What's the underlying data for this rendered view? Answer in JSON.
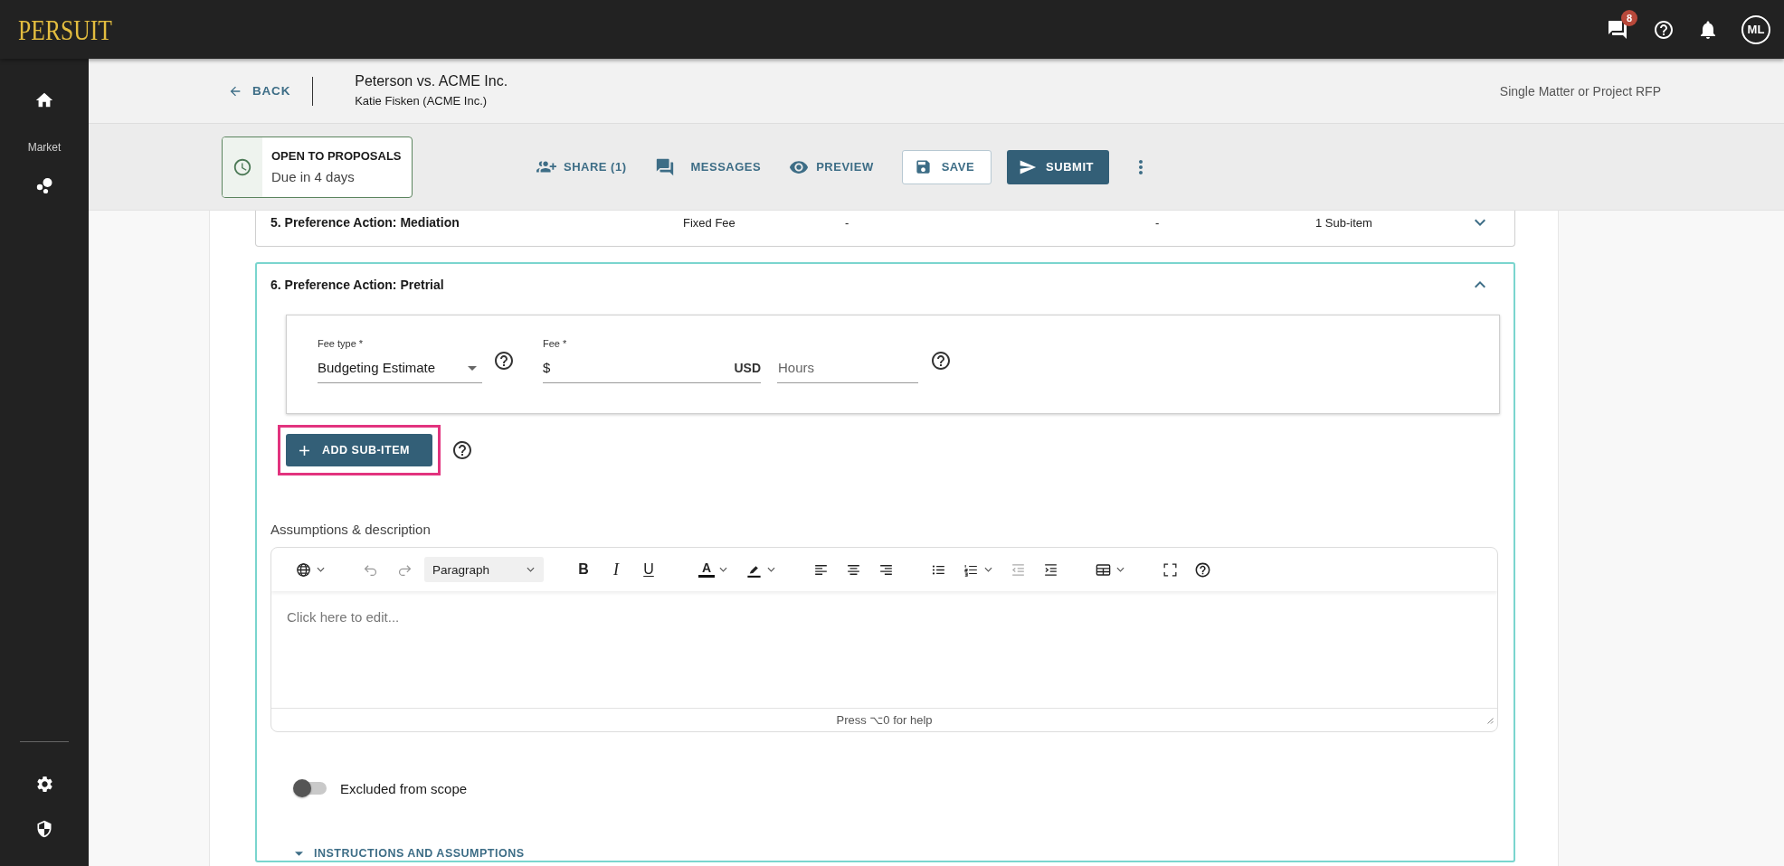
{
  "app_bar": {
    "logo": "PERSUIT",
    "messages_badge": "8",
    "avatar_initials": "ML"
  },
  "sidebar": {
    "section_label": "Market"
  },
  "header": {
    "back_label": "BACK",
    "title": "Peterson vs. ACME Inc.",
    "subtitle": "Katie Fisken (ACME Inc.)",
    "rfp_type": "Single Matter or Project RFP"
  },
  "status": {
    "title": "OPEN TO PROPOSALS",
    "due": "Due in 4 days"
  },
  "actions": [
    {
      "kind": "share",
      "label": "SHARE (1)"
    },
    {
      "kind": "messages",
      "label": "MESSAGES"
    },
    {
      "kind": "preview",
      "label": "PREVIEW"
    },
    {
      "kind": "save",
      "label": "SAVE"
    },
    {
      "kind": "submit",
      "label": "SUBMIT"
    }
  ],
  "line_items": [
    {
      "title": "5. Preference Action: Mediation",
      "expanded": false,
      "cells": [
        "Fixed Fee",
        "-",
        "-",
        "1 Sub-item"
      ]
    },
    {
      "title": "6. Preference Action: Pretrial",
      "expanded": true,
      "details": {
        "fee_type": {
          "label": "Fee type *",
          "value": "Budgeting Estimate"
        },
        "fee": {
          "label": "Fee *",
          "prefix": "$",
          "currency": "USD"
        },
        "hours": {
          "placeholder": "Hours"
        },
        "add_sub_item": {
          "label": "ADD SUB-ITEM",
          "highlighted": true
        },
        "description": {
          "label": "Assumptions & description",
          "block_format": "Paragraph",
          "format_buttons": [
            {
              "kind": "bold",
              "label": "B"
            },
            {
              "kind": "italic",
              "label": "I"
            },
            {
              "kind": "underline",
              "label": "U"
            }
          ],
          "text_color_label": "A",
          "placeholder": "Click here to edit...",
          "help_hint": "Press ⌥0 for help"
        },
        "excluded_from_scope": {
          "label": "Excluded from scope",
          "on": false
        },
        "instructions": {
          "label": "INSTRUCTIONS AND ASSUMPTIONS"
        }
      }
    }
  ]
}
